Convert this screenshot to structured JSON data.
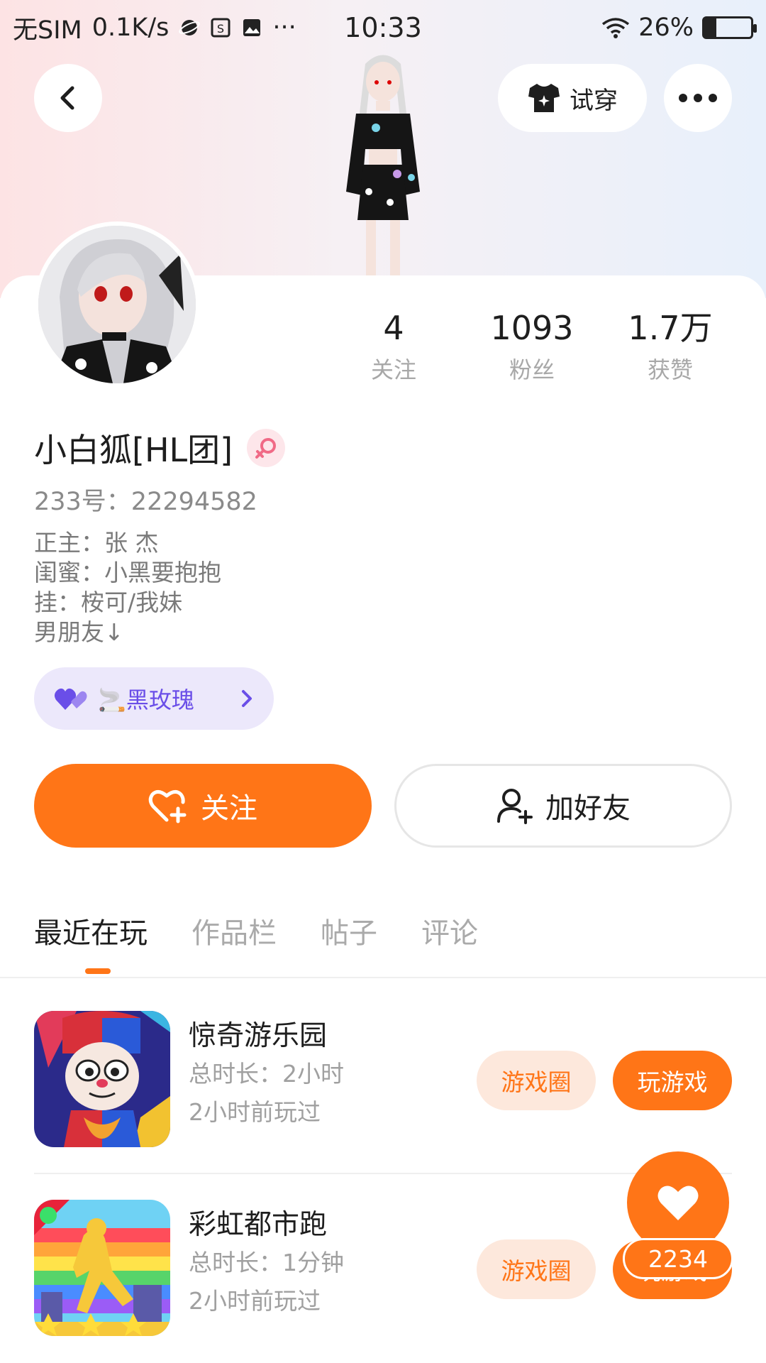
{
  "status_bar": {
    "carrier": "无SIM",
    "net_speed": "0.1K/s",
    "time": "10:33",
    "battery": "26%",
    "battery_level": 0.26
  },
  "header": {
    "try_on_label": "试穿"
  },
  "profile": {
    "name": "小白狐[HL团]",
    "id_line": "233号：22294582",
    "bio": [
      "正主：张 杰",
      "闺蜜：小黑要抱抱",
      "挂：桉可/我妹",
      "男朋友↓"
    ],
    "tag_label": "黑玫瑰",
    "tag_emoji": "🚬"
  },
  "stats": [
    {
      "value": "4",
      "label": "关注"
    },
    {
      "value": "1093",
      "label": "粉丝"
    },
    {
      "value": "1.7万",
      "label": "获赞"
    }
  ],
  "actions": {
    "follow": "关注",
    "add_friend": "加好友"
  },
  "tabs": [
    "最近在玩",
    "作品栏",
    "帖子",
    "评论"
  ],
  "games": [
    {
      "title": "惊奇游乐园",
      "duration": "总时长：2小时",
      "last_played": "2小时前玩过",
      "circle_btn": "游戏圈",
      "play_btn": "玩游戏"
    },
    {
      "title": "彩虹都市跑",
      "duration": "总时长：1分钟",
      "last_played": "2小时前玩过",
      "circle_btn": "游戏圈",
      "play_btn": "玩游戏"
    }
  ],
  "fab": {
    "count": "2234"
  },
  "colors": {
    "accent": "#ff7517",
    "tag_purple": "#6a4ee8"
  }
}
